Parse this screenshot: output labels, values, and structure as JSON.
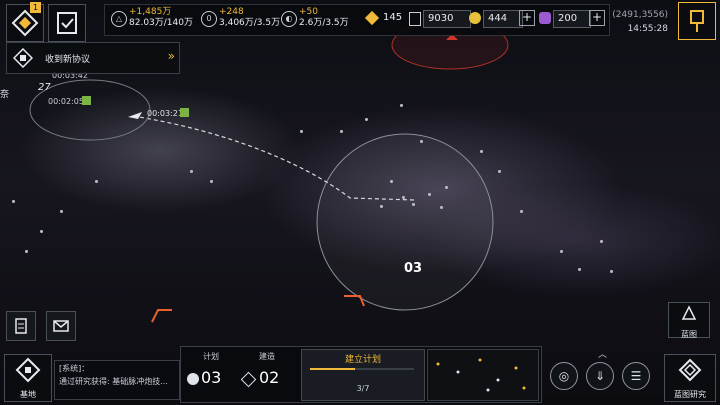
{
  "header": {
    "notify_badge": "1",
    "resources": [
      {
        "icon": "metal-icon",
        "glyph": "△",
        "increase": "+1,485万",
        "amount": "82.03万/140万"
      },
      {
        "icon": "crystal-icon",
        "glyph": "0",
        "increase": "+248",
        "amount": "3,406万/3.5万"
      },
      {
        "icon": "gas-icon",
        "glyph": "◐",
        "increase": "+50",
        "amount": "2.6万/3.5万"
      }
    ],
    "currency1": "145",
    "currency2": "9030",
    "currency3": "444",
    "currency4": "200",
    "coords": "(2491,3556)",
    "time": "14:55:28"
  },
  "notice": {
    "label": "收到新协议",
    "arrow": "»"
  },
  "map": {
    "fleet_timer_1": "00:03:42",
    "fleet_timer_2": "00:02:05",
    "fleet_timer_3": "00:03:21",
    "left_label": "奈",
    "node_code": "03",
    "cluster_label": "27"
  },
  "side": {
    "blueprint_label": "蓝图",
    "blueprint_research_label": "蓝图研究"
  },
  "bottom_left": {
    "base_label": "基地",
    "channel": "[系统]：",
    "message": "通过研究获得: 基础脉冲炮技..."
  },
  "plan_panel": {
    "plan_header": "计划",
    "build_header": "建造",
    "plan_count": "03",
    "build_count": "02",
    "establish_title": "建立计划",
    "progress_text": "3/7",
    "progress_value": 3,
    "progress_max": 7
  },
  "colors": {
    "accent": "#f0b93a",
    "orange_frame": "#e8612c",
    "red_zone": "#d0362a"
  }
}
